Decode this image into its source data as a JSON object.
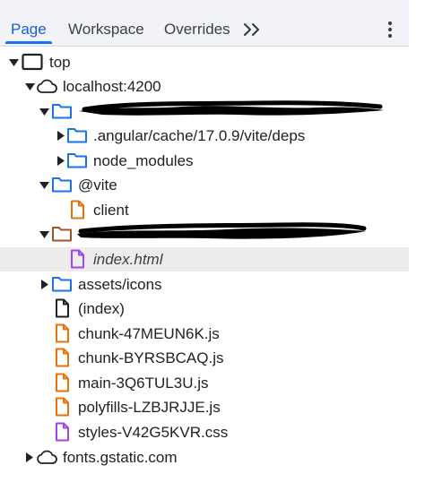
{
  "tabs": [
    {
      "label": "Page",
      "active": true
    },
    {
      "label": "Workspace",
      "active": false
    },
    {
      "label": "Overrides",
      "active": false
    }
  ],
  "more_tabs_icon": "double-chevron-right-icon",
  "menu_icon": "vertical-ellipsis-icon",
  "colors": {
    "accent": "#1a73e8",
    "folder_blue": "#1a73e8",
    "folder_brown": "#a0522d",
    "script_orange": "#e8710a",
    "style_purple": "#a142f4",
    "selected_row": "#ececec"
  },
  "tree": [
    {
      "label": "top",
      "icon": "frame-icon",
      "expanded": true
    },
    {
      "label": "localhost:4200",
      "icon": "cloud-icon",
      "expanded": true
    },
    {
      "label": "",
      "icon": "folder-icon",
      "expanded": true,
      "redacted": true
    },
    {
      "label": ".angular/cache/17.0.9/vite/deps",
      "icon": "folder-icon",
      "expanded": false
    },
    {
      "label": "node_modules",
      "icon": "folder-icon",
      "expanded": false
    },
    {
      "label": "@vite",
      "icon": "folder-icon",
      "expanded": true
    },
    {
      "label": "client",
      "icon": "script-file-icon"
    },
    {
      "label": "",
      "icon": "folder-icon",
      "expanded": true,
      "redacted": true
    },
    {
      "label": "index.html",
      "icon": "document-file-icon",
      "selected": true
    },
    {
      "label": "assets/icons",
      "icon": "folder-icon",
      "expanded": false
    },
    {
      "label": "(index)",
      "icon": "document-file-icon"
    },
    {
      "label": "chunk-47MEUN6K.js",
      "icon": "script-file-icon"
    },
    {
      "label": "chunk-BYRSBCAQ.js",
      "icon": "script-file-icon"
    },
    {
      "label": "main-3Q6TUL3U.js",
      "icon": "script-file-icon"
    },
    {
      "label": "polyfills-LZBJRJJE.js",
      "icon": "script-file-icon"
    },
    {
      "label": "styles-V42G5KVR.css",
      "icon": "stylesheet-file-icon"
    },
    {
      "label": "fonts.gstatic.com",
      "icon": "cloud-icon",
      "expanded": false
    }
  ]
}
